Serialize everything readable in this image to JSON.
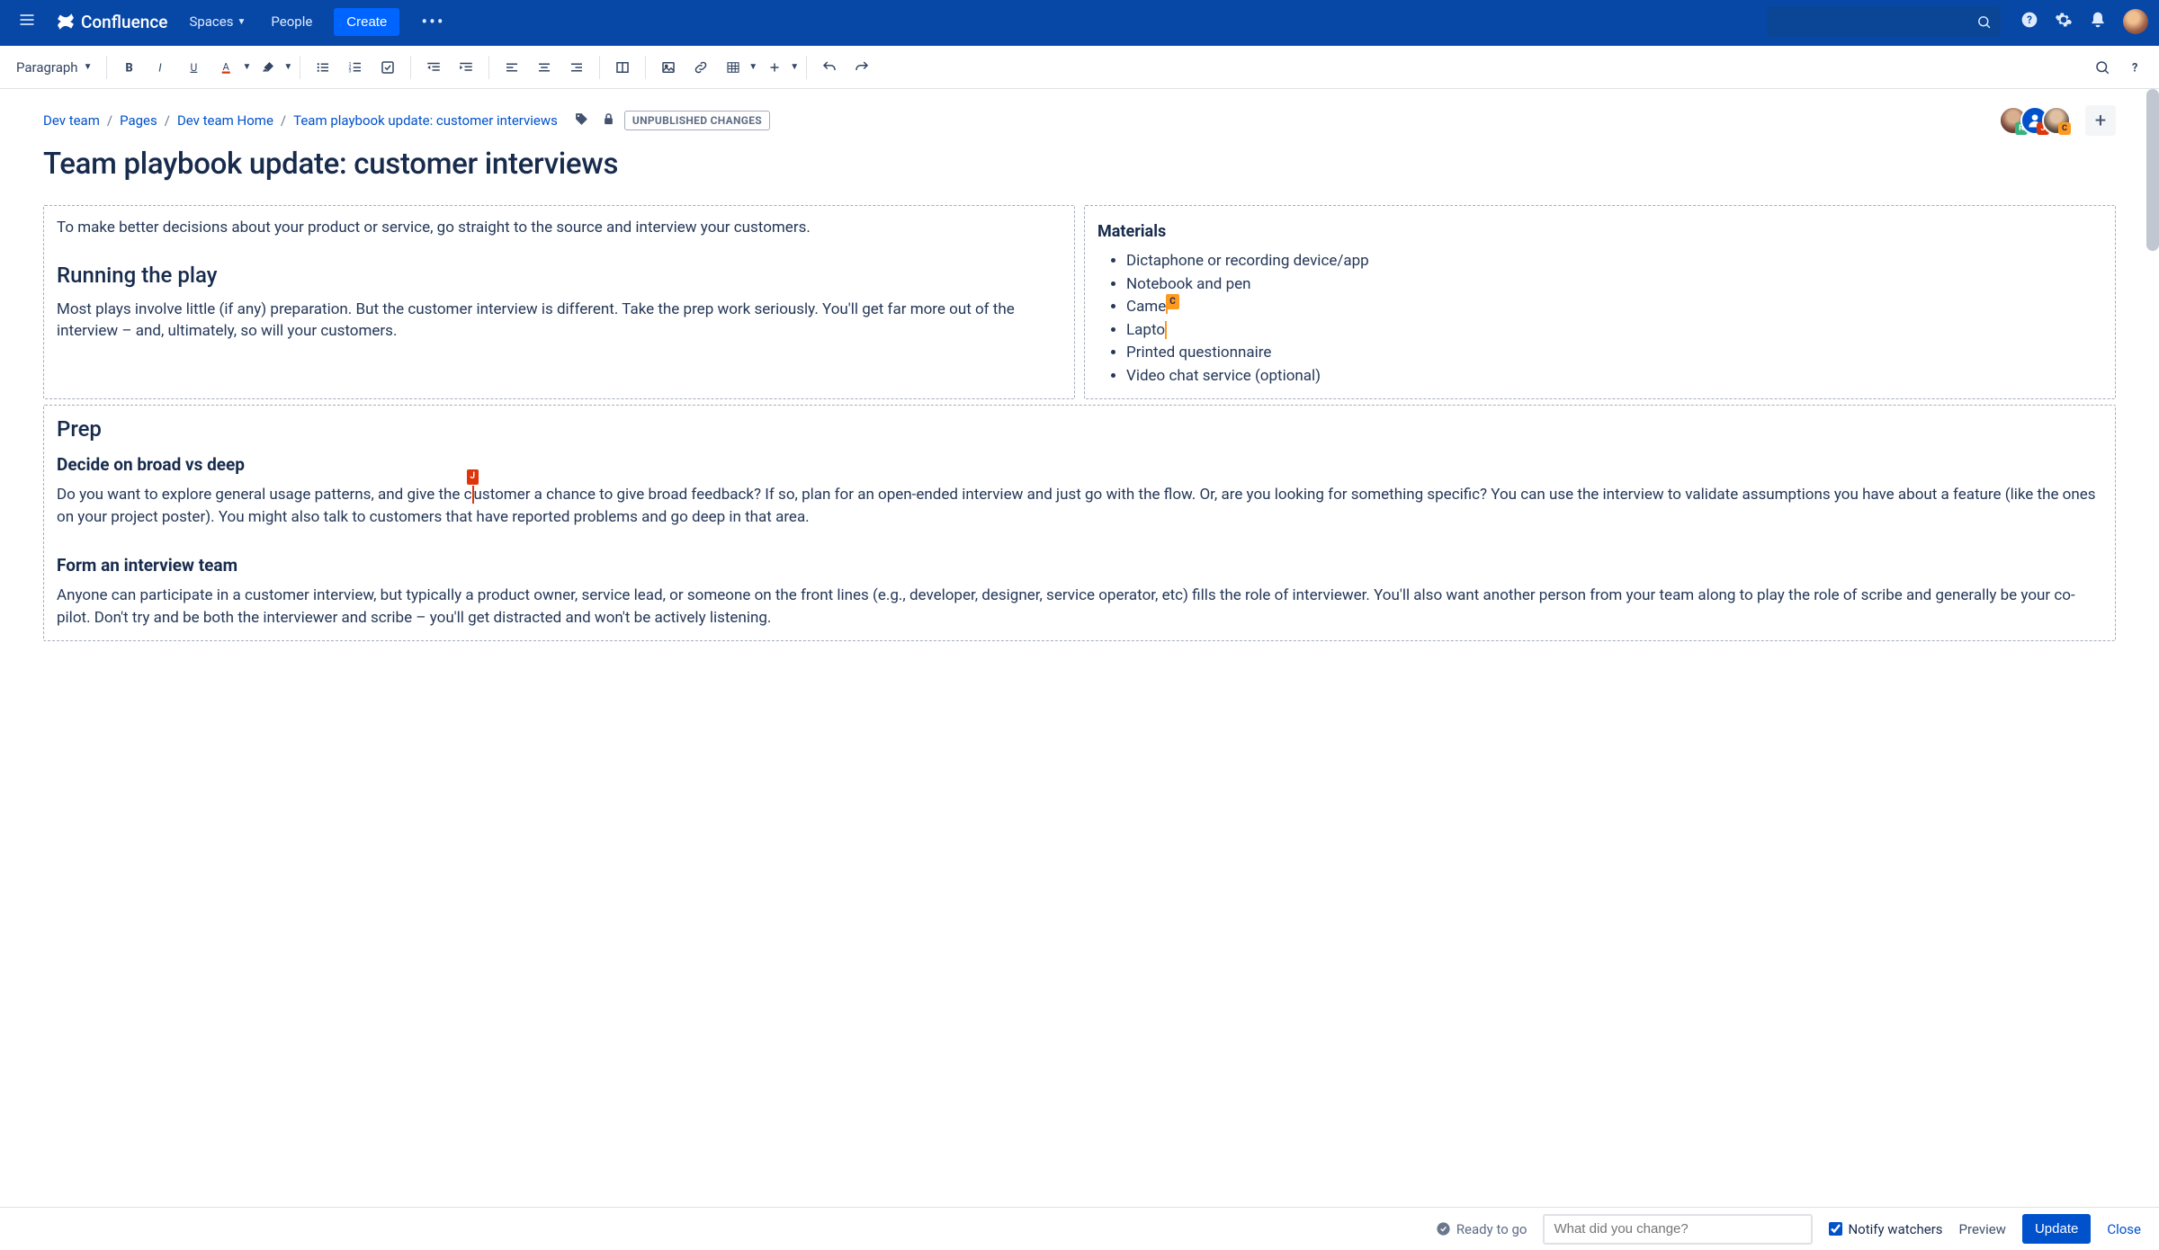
{
  "topnav": {
    "product": "Confluence",
    "spaces": "Spaces",
    "people": "People",
    "create": "Create"
  },
  "toolbar": {
    "paragraph_label": "Paragraph"
  },
  "breadcrumbs": {
    "items": [
      "Dev team",
      "Pages",
      "Dev team Home",
      "Team playbook update: customer interviews"
    ]
  },
  "status_badge": "UNPUBLISHED CHANGES",
  "presence": {
    "u1_initial": "R",
    "u2_initial": "J",
    "u3_initial": "C"
  },
  "page_title": "Team playbook update: customer interviews",
  "cell_left": {
    "intro": "To make better decisions about your product or service, go straight to the source and interview your customers.",
    "h2": "Running the play",
    "p": "Most plays involve little (if any) preparation. But the customer interview is different. Take the prep work seriously. You'll get far more out of the interview – and, ultimately, so will your customers."
  },
  "cell_right": {
    "h3": "Materials",
    "items": [
      "Dictaphone or recording device/app",
      "Notebook and pen",
      "Came",
      "Lapto",
      "Printed questionnaire",
      "Video chat service (optional)"
    ],
    "cursor_c": "C",
    "item2_suffix": ""
  },
  "cell_bottom": {
    "h2": "Prep",
    "h3a": "Decide on broad vs deep",
    "cursor_j": "J",
    "p1a": "Do you want to explore general usage patterns, and give the c",
    "p1b": "ustomer a chance to give broad feedback? If so, plan for an open-ended interview and just go with the flow. Or, are you looking for something specific? You can use the interview to validate assumptions you have about a feature (like the ones on your project poster). You might also talk to customers that have reported problems and go deep in that area.",
    "h3b": "Form an interview team",
    "p2": "Anyone can participate in a customer interview, but typically a product owner, service lead, or someone on the front lines (e.g., developer, designer, service operator, etc) fills the role of interviewer. You'll also want another person from your team along to play the role of scribe and generally be your co-pilot. Don't try and be both the interviewer and scribe – you'll get distracted and won't be actively listening."
  },
  "footer": {
    "ready": "Ready to go",
    "comment_placeholder": "What did you change?",
    "notify": "Notify watchers",
    "preview": "Preview",
    "update": "Update",
    "close": "Close"
  }
}
